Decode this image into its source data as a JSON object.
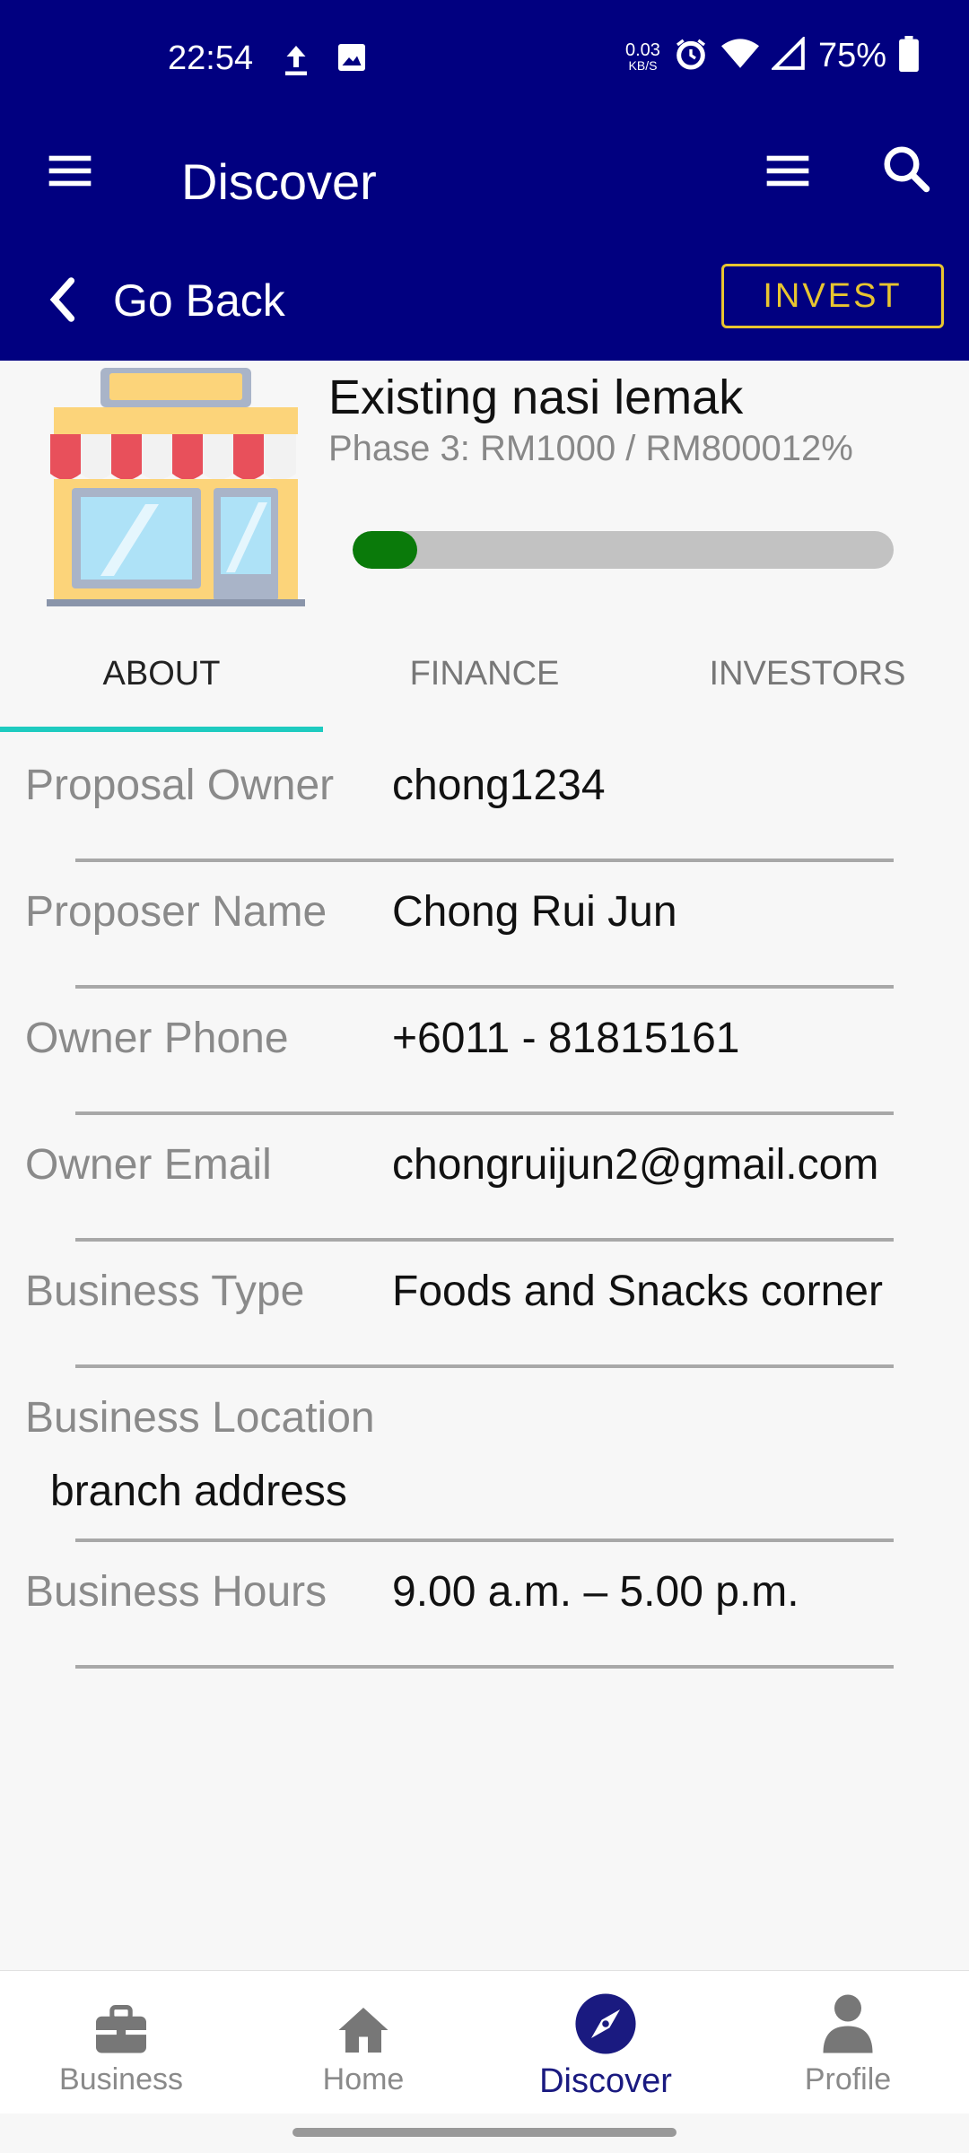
{
  "status_bar": {
    "time": "22:54",
    "net_speed": "0.03",
    "net_unit": "KB/S",
    "battery": "75%"
  },
  "app_bar": {
    "title": "Discover"
  },
  "back_bar": {
    "back_label": "Go Back",
    "invest_label": "INVEST"
  },
  "project": {
    "title": "Existing nasi lemak",
    "phase": "Phase 3: RM1000 / RM800012%",
    "progress_fraction": 0.12
  },
  "tabs": [
    {
      "label": "ABOUT",
      "active": true
    },
    {
      "label": "FINANCE",
      "active": false
    },
    {
      "label": "INVESTORS",
      "active": false
    }
  ],
  "details": [
    {
      "label": "Proposal Owner",
      "value": "chong1234"
    },
    {
      "label": "Proposer Name",
      "value": "Chong Rui Jun"
    },
    {
      "label": "Owner Phone",
      "value": "+6011 - 81815161"
    },
    {
      "label": "Owner Email",
      "value": "chongruijun2@gmail.com"
    },
    {
      "label": "Business Type",
      "value": "Foods and Snacks corner"
    },
    {
      "label": "Business Location",
      "value": "branch address"
    },
    {
      "label": "Business Hours",
      "value": "9.00 a.m. – 5.00 p.m."
    }
  ],
  "bottom_nav": [
    {
      "label": "Business",
      "icon": "briefcase-icon",
      "active": false
    },
    {
      "label": "Home",
      "icon": "home-icon",
      "active": false
    },
    {
      "label": "Discover",
      "icon": "compass-icon",
      "active": true
    },
    {
      "label": "Profile",
      "icon": "person-icon",
      "active": false
    }
  ],
  "colors": {
    "primary": "#010080",
    "accent_gold": "#e8c530",
    "tab_indicator": "#1ecbc0",
    "progress_fill": "#0a7a0a"
  }
}
